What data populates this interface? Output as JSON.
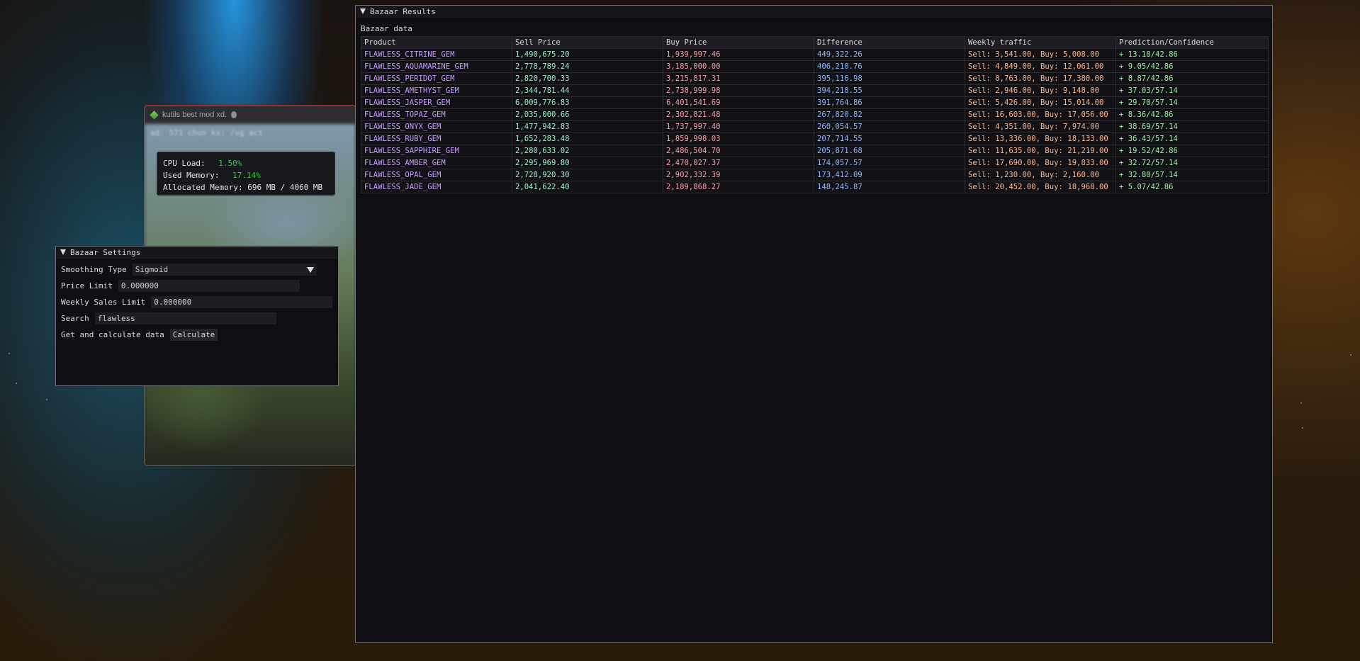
{
  "background_window": {
    "title": "kutils best mod xd.",
    "blurred_text": "ad: 571 chun ks: /vg act"
  },
  "performance": {
    "cpu_label": "CPU Load:",
    "cpu_value": "1.50%",
    "used_label": "Used Memory:",
    "used_value": "17.14%",
    "alloc_label": "Allocated Memory:",
    "alloc_value": "696 MB / 4060 MB"
  },
  "settings": {
    "title": "Bazaar Settings",
    "smoothing_label": "Smoothing Type",
    "smoothing_value": "Sigmoid",
    "price_limit_label": "Price Limit",
    "price_limit_value": "0.000000",
    "weekly_label": "Weekly Sales Limit",
    "weekly_value": "0.000000",
    "search_label": "Search",
    "search_value": "flawless",
    "calc_label": "Get and calculate data",
    "calc_button": "Calculate"
  },
  "results": {
    "title": "Bazaar Results",
    "subtitle": "Bazaar data",
    "columns": [
      "Product",
      "Sell Price",
      "Buy Price",
      "Difference",
      "Weekly traffic",
      "Prediction/Confidence"
    ],
    "rows": [
      [
        "FLAWLESS_CITRINE_GEM",
        "1,490,675.20",
        "1,939,997.46",
        "449,322.26",
        "Sell: 3,541.00, Buy: 5,008.00",
        "+ 13.18/42.86"
      ],
      [
        "FLAWLESS_AQUAMARINE_GEM",
        "2,778,789.24",
        "3,185,000.00",
        "406,210.76",
        "Sell: 4,849.00, Buy: 12,061.00",
        "+ 9.05/42.86"
      ],
      [
        "FLAWLESS_PERIDOT_GEM",
        "2,820,700.33",
        "3,215,817.31",
        "395,116.98",
        "Sell: 8,763.00, Buy: 17,380.00",
        "+ 8.87/42.86"
      ],
      [
        "FLAWLESS_AMETHYST_GEM",
        "2,344,781.44",
        "2,738,999.98",
        "394,218.55",
        "Sell: 2,946.00, Buy: 9,148.00",
        "+ 37.03/57.14"
      ],
      [
        "FLAWLESS_JASPER_GEM",
        "6,009,776.83",
        "6,401,541.69",
        "391,764.86",
        "Sell: 5,426.00, Buy: 15,014.00",
        "+ 29.70/57.14"
      ],
      [
        "FLAWLESS_TOPAZ_GEM",
        "2,035,000.66",
        "2,302,821.48",
        "267,820.82",
        "Sell: 16,603.00, Buy: 17,056.00",
        "+ 8.36/42.86"
      ],
      [
        "FLAWLESS_ONYX_GEM",
        "1,477,942.83",
        "1,737,997.40",
        "260,054.57",
        "Sell: 4,351.00, Buy: 7,974.00",
        "+ 38.69/57.14"
      ],
      [
        "FLAWLESS_RUBY_GEM",
        "1,652,283.48",
        "1,859,998.03",
        "207,714.55",
        "Sell: 13,336.00, Buy: 18,133.00",
        "+ 36.43/57.14"
      ],
      [
        "FLAWLESS_SAPPHIRE_GEM",
        "2,280,633.02",
        "2,486,504.70",
        "205,871.68",
        "Sell: 11,635.00, Buy: 21,219.00",
        "+ 19.52/42.86"
      ],
      [
        "FLAWLESS_AMBER_GEM",
        "2,295,969.80",
        "2,470,027.37",
        "174,057.57",
        "Sell: 17,690.00, Buy: 19,833.00",
        "+ 32.72/57.14"
      ],
      [
        "FLAWLESS_OPAL_GEM",
        "2,728,920.30",
        "2,902,332.39",
        "173,412.09",
        "Sell: 1,230.00, Buy: 2,160.00",
        "+ 32.80/57.14"
      ],
      [
        "FLAWLESS_JADE_GEM",
        "2,041,622.40",
        "2,189,868.27",
        "148,245.87",
        "Sell: 20,452.00, Buy: 18,968.00",
        "+ 5.07/42.86"
      ]
    ]
  },
  "colors": {
    "product": "#c99bff",
    "sell": "#9ff0c9",
    "buy": "#ff9fa8",
    "difference": "#8fb8ff",
    "traffic": "#ffb68a",
    "prediction": "#9df0a6",
    "percent_value": "#27d13b",
    "window_border": "#a64646"
  }
}
